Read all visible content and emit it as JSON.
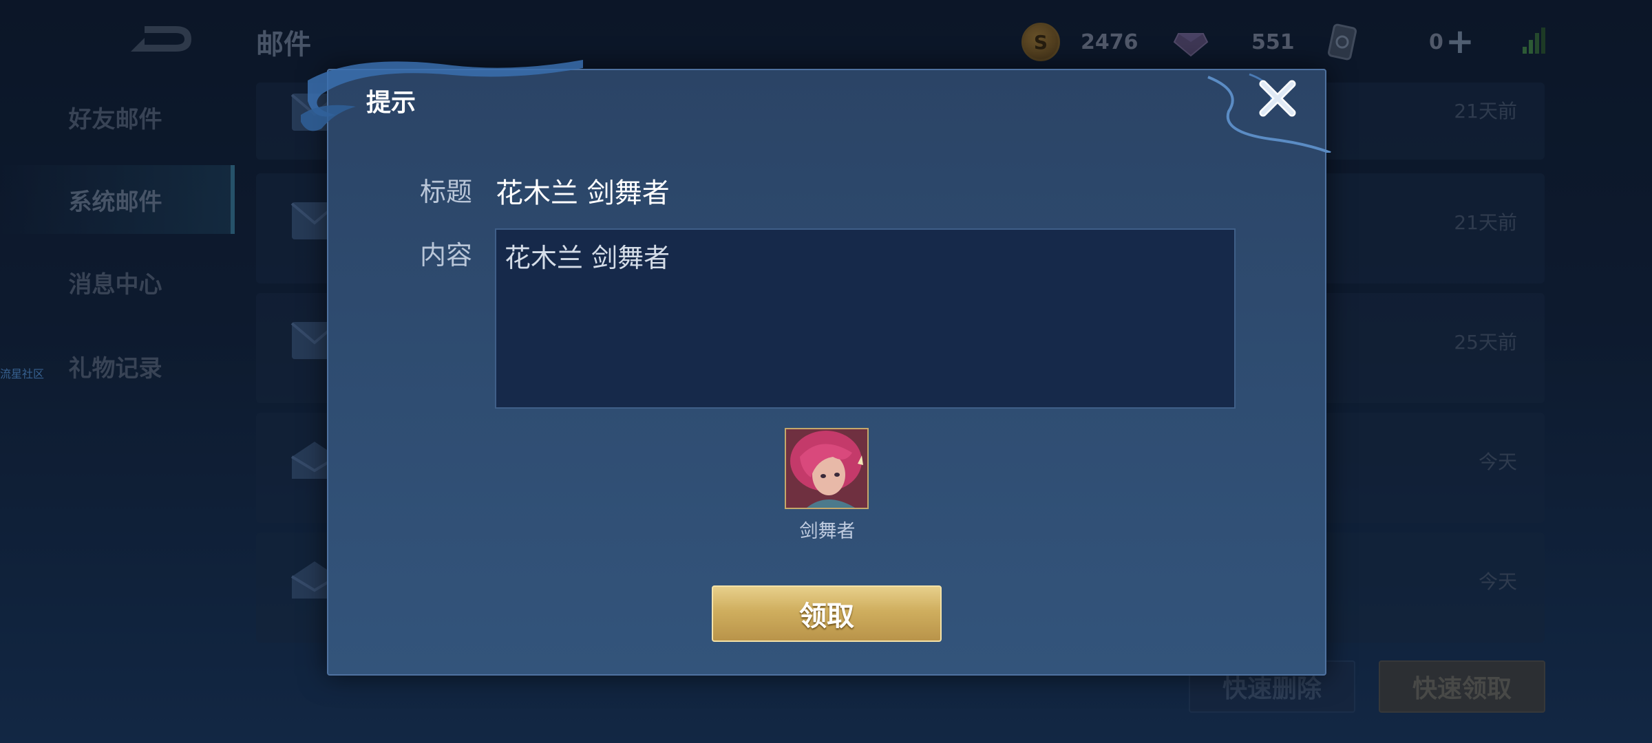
{
  "app": {
    "page_title": "邮件"
  },
  "currency": {
    "coins": "2476",
    "gems": "551",
    "cards": "0"
  },
  "side_nav": {
    "items": [
      {
        "label": "好友邮件"
      },
      {
        "label": "系统邮件"
      },
      {
        "label": "消息中心"
      },
      {
        "label": "礼物记录"
      }
    ],
    "community_link": "流星社区"
  },
  "mail_list": {
    "rows": [
      {
        "time": "21天前"
      },
      {
        "time": "21天前"
      },
      {
        "time": "25天前"
      },
      {
        "time": "今天"
      },
      {
        "time": "今天"
      }
    ]
  },
  "bottom_actions": {
    "delete_label": "快速删除",
    "claim_all_label": "快速领取"
  },
  "dialog": {
    "header": "提示",
    "title_label": "标题",
    "title_value": "花木兰 剑舞者",
    "content_label": "内容",
    "content_value": "花木兰 剑舞者",
    "reward": {
      "name": "剑舞者"
    },
    "claim_label": "领取"
  },
  "colors": {
    "accent_gold": "#cfae5e",
    "panel_blue": "#2f4d72",
    "active_nav": "#3e8bab"
  }
}
